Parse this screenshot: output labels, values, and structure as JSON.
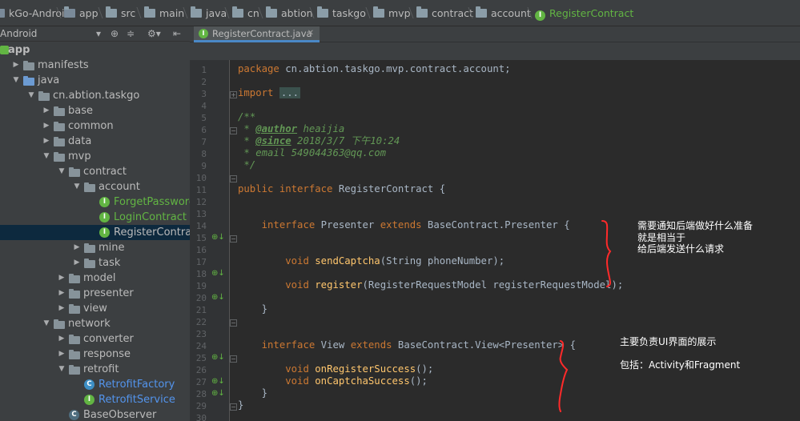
{
  "breadcrumb": [
    {
      "label": "kGo-Android",
      "icon": "module-folder-icon"
    },
    {
      "label": "app",
      "icon": "module-folder-icon"
    },
    {
      "label": "src",
      "icon": "folder-icon"
    },
    {
      "label": "main",
      "icon": "folder-icon"
    },
    {
      "label": "java",
      "icon": "folder-icon"
    },
    {
      "label": "cn",
      "icon": "folder-icon"
    },
    {
      "label": "abtion",
      "icon": "folder-icon"
    },
    {
      "label": "taskgo",
      "icon": "folder-icon"
    },
    {
      "label": "mvp",
      "icon": "folder-icon"
    },
    {
      "label": "contract",
      "icon": "folder-icon"
    },
    {
      "label": "account",
      "icon": "folder-icon"
    },
    {
      "label": "RegisterContract",
      "icon": "interface-icon"
    }
  ],
  "project_view": {
    "label": "Android"
  },
  "tree": [
    {
      "label": "app",
      "icon": "module",
      "style": "bold"
    },
    {
      "label": "manifests",
      "icon": "folder",
      "arrow": "right"
    },
    {
      "label": "java",
      "icon": "src",
      "arrow": "down"
    },
    {
      "label": "cn.abtion.taskgo",
      "icon": "folder",
      "arrow": "down"
    },
    {
      "label": "base",
      "icon": "folder",
      "arrow": "right"
    },
    {
      "label": "common",
      "icon": "folder",
      "arrow": "right"
    },
    {
      "label": "data",
      "icon": "folder",
      "arrow": "right"
    },
    {
      "label": "mvp",
      "icon": "folder",
      "arrow": "down"
    },
    {
      "label": "contract",
      "icon": "folder",
      "arrow": "down"
    },
    {
      "label": "account",
      "icon": "folder",
      "arrow": "down"
    },
    {
      "label": "ForgetPasswordContract",
      "icon": "interface",
      "style": "green"
    },
    {
      "label": "LoginContract",
      "icon": "interface",
      "style": "green"
    },
    {
      "label": "RegisterContract",
      "icon": "interface",
      "style": "normal",
      "selected": true
    },
    {
      "label": "mine",
      "icon": "folder",
      "arrow": "right"
    },
    {
      "label": "task",
      "icon": "folder",
      "arrow": "right"
    },
    {
      "label": "model",
      "icon": "folder",
      "arrow": "right"
    },
    {
      "label": "presenter",
      "icon": "folder",
      "arrow": "right"
    },
    {
      "label": "view",
      "icon": "folder",
      "arrow": "right"
    },
    {
      "label": "network",
      "icon": "folder",
      "arrow": "down"
    },
    {
      "label": "converter",
      "icon": "folder",
      "arrow": "right"
    },
    {
      "label": "response",
      "icon": "folder",
      "arrow": "right"
    },
    {
      "label": "retrofit",
      "icon": "folder",
      "arrow": "down"
    },
    {
      "label": "RetrofitFactory",
      "icon": "class",
      "style": "blue"
    },
    {
      "label": "RetrofitService",
      "icon": "interface",
      "style": "blue"
    },
    {
      "label": "BaseObserver",
      "icon": "class-gray",
      "style": "normal"
    }
  ],
  "tab": {
    "label": "RegisterContract.java"
  },
  "code": {
    "l1": {
      "kw": "package",
      "rest": " cn.abtion.taskgo.mvp.contract.account;"
    },
    "l3": {
      "kw": "import",
      "fold": "..."
    },
    "l6": "/**",
    "l7": {
      "star": " * ",
      "tag": "@author",
      "text": " heaijia"
    },
    "l8": {
      "star": " * ",
      "tag": "@since",
      "text": " 2018/3/7 下午10:24"
    },
    "l9": " * email 549044363@qq.com",
    "l10": " */",
    "l12": {
      "kw": "public interface",
      "rest": " RegisterContract {"
    },
    "l15": {
      "kw1": "interface",
      "mid": " Presenter ",
      "kw2": "extends",
      "rest": " BaseContract.Presenter {"
    },
    "l18": {
      "kw": "void",
      "fn": "sendCaptcha",
      "rest": "(String phoneNumber);"
    },
    "l20": {
      "kw": "void",
      "fn": "register",
      "rest": "(RegisterRequestModel registerRequestModel);"
    },
    "l22": "}",
    "l25": {
      "kw1": "interface",
      "mid": " View ",
      "kw2": "extends",
      "rest": " BaseContract.View<Presenter> {"
    },
    "l27": {
      "kw": "void",
      "fn": "onRegisterSuccess",
      "rest": "();"
    },
    "l28": {
      "kw": "void",
      "fn": "onCaptchaSuccess",
      "rest": "();"
    },
    "l29": "}",
    "l30": "}"
  },
  "annotations": {
    "presenter_note": [
      "需要通知后端做好什么准备",
      "就是相当于",
      "给后端发送什么请求"
    ],
    "view_note_1": "主要负责UI界面的展示",
    "view_note_2": "包括：Activity和Fragment"
  },
  "colors": {
    "keyword": "#cc7832",
    "method": "#ffc66d",
    "comment": "#629755",
    "annotation_brace": "#ff2a2a"
  }
}
